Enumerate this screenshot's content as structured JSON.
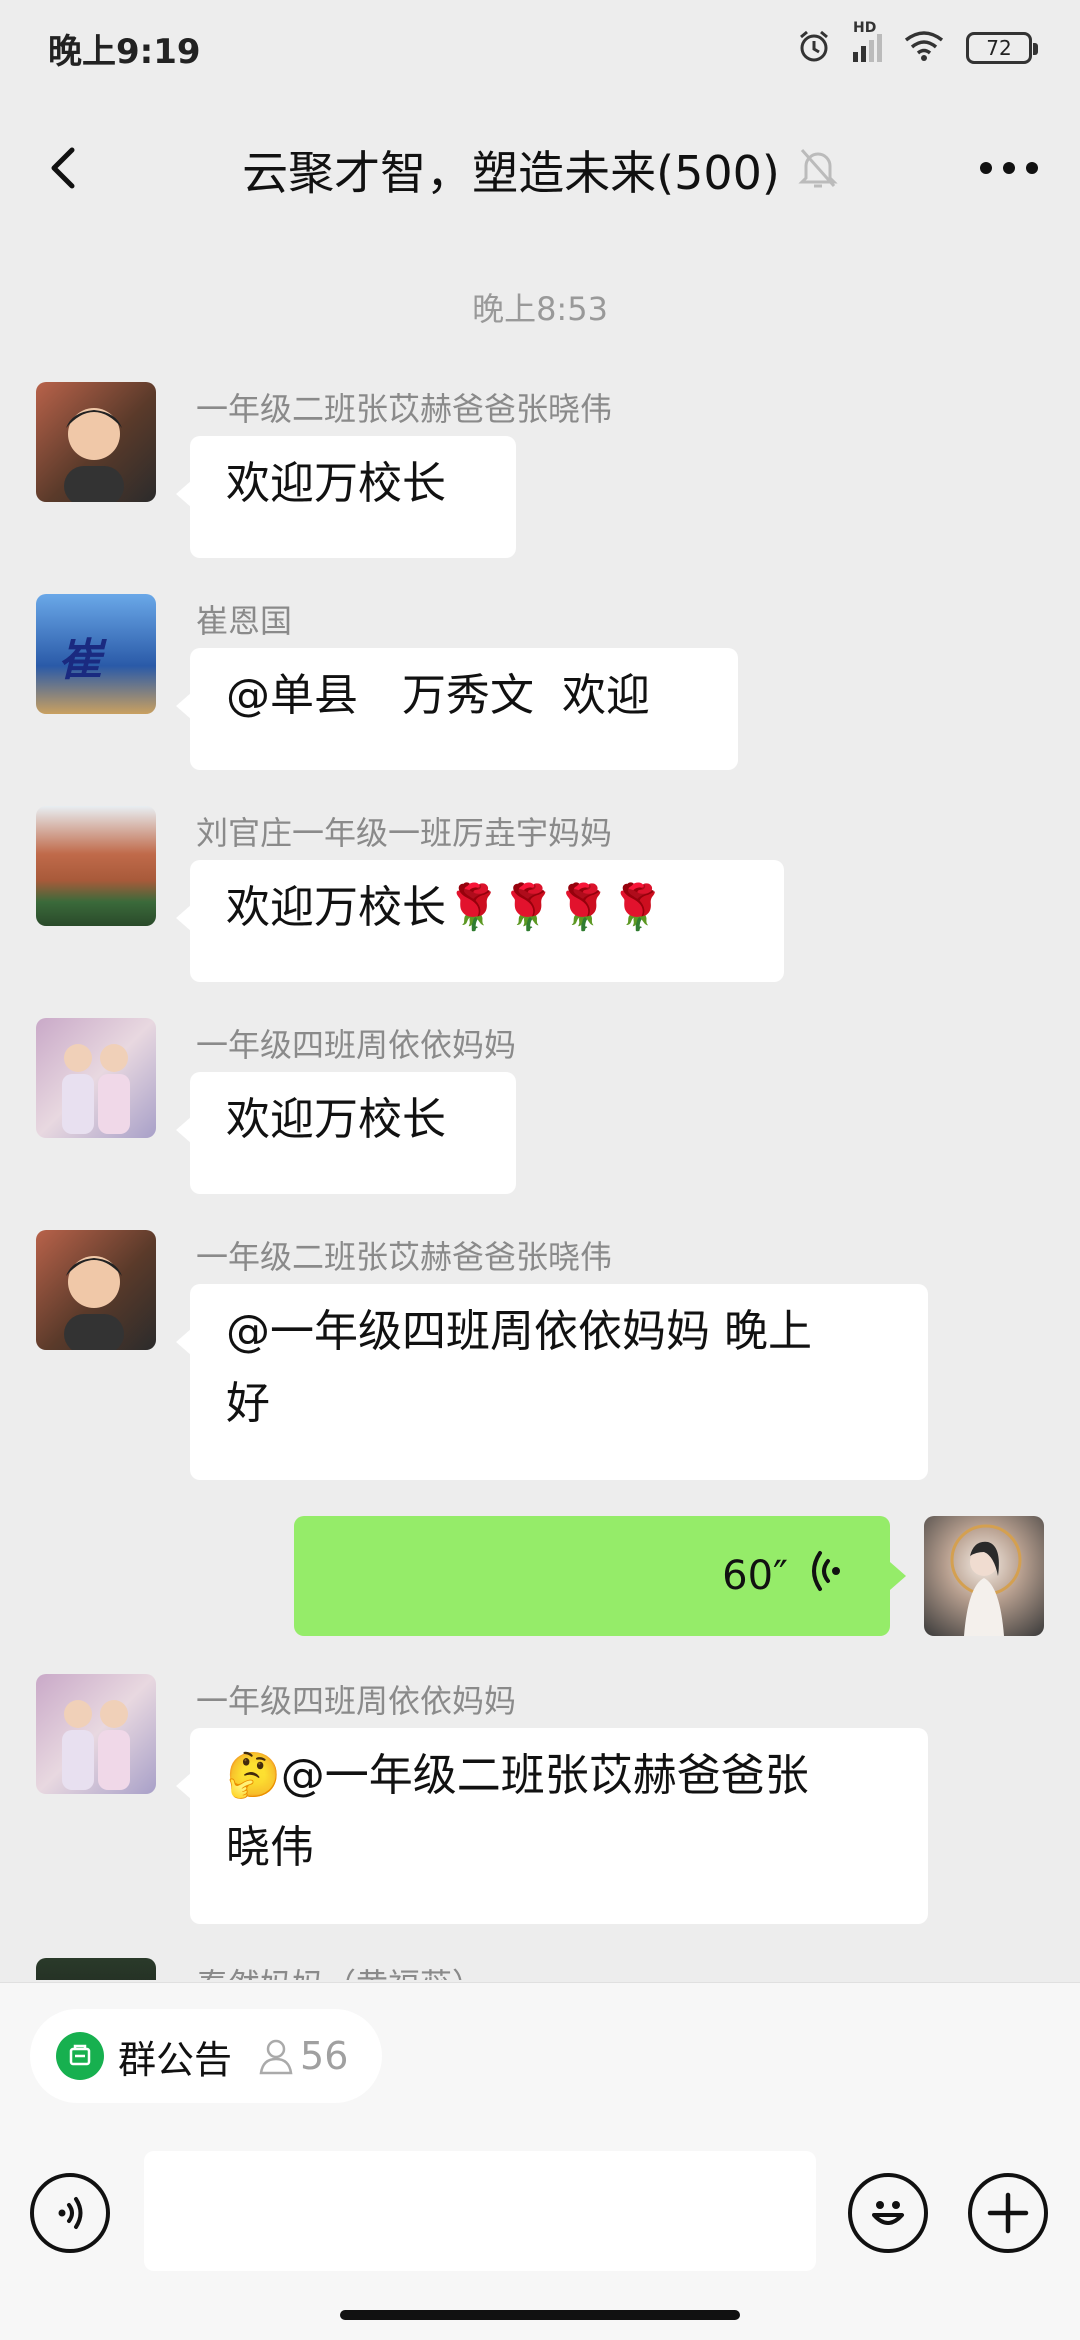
{
  "status_bar": {
    "time": "晚上9:19",
    "battery": "72",
    "network": "HD"
  },
  "header": {
    "title": "云聚才智，塑造未来(500)"
  },
  "chat": {
    "timestamp": "晚上8:53",
    "messages": [
      {
        "sender": "一年级二班张苡赫爸爸张晓伟",
        "text": "欢迎万校长"
      },
      {
        "sender": "崔恩国",
        "text": "@单县　万秀文  欢迎",
        "avatar_text": "崔"
      },
      {
        "sender": "刘官庄一年级一班厉垚宇妈妈",
        "text": "欢迎万校长🌹🌹🌹🌹"
      },
      {
        "sender": "一年级四班周依依妈妈",
        "text": "欢迎万校长"
      },
      {
        "sender": "一年级二班张苡赫爸爸张晓伟",
        "text_line1": "@一年级四班周依依妈妈  晚上",
        "text_line2": "好"
      },
      {
        "self": true,
        "voice_duration": "60″"
      },
      {
        "sender": "一年级四班周依依妈妈",
        "text_line1": "🤔@一年级二班张苡赫爸爸张",
        "text_line2": "晓伟"
      },
      {
        "sender": "秦然妈妈（黄福蕊）"
      }
    ]
  },
  "bottom": {
    "notice_label": "群公告",
    "member_count": "56"
  },
  "colors": {
    "self_bubble": "#95ec69",
    "notice_icon": "#17b04f",
    "background": "#ededed"
  }
}
